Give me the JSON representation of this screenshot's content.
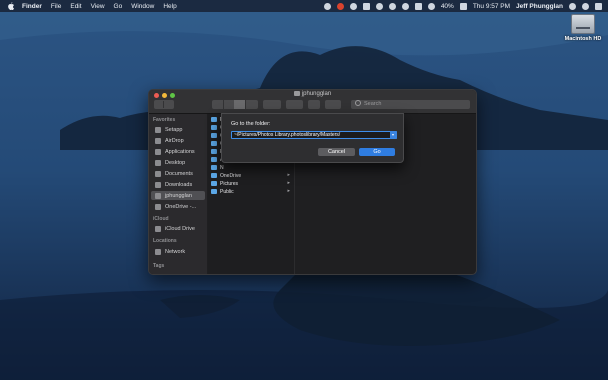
{
  "menubar": {
    "items": [
      "Finder",
      "File",
      "Edit",
      "View",
      "Go",
      "Window",
      "Help"
    ],
    "battery": "40%",
    "clock": "Thu 9:57 PM",
    "user": "Jeff Phungglan"
  },
  "desktop": {
    "disk_label": "Macintosh HD"
  },
  "finder": {
    "title": "jphungglan",
    "search_placeholder": "Search",
    "sidebar": {
      "favorites_header": "Favorites",
      "favorites": [
        "Setapp",
        "AirDrop",
        "Applications",
        "Desktop",
        "Documents",
        "Downloads",
        "jphungglan",
        "OneDrive -..."
      ],
      "icloud_header": "iCloud",
      "icloud": [
        "iCloud Drive"
      ],
      "locations_header": "Locations",
      "locations": [
        "Network"
      ],
      "tags_header": "Tags"
    },
    "column": {
      "items": [
        "P",
        "C",
        "C",
        "C",
        "F",
        "A",
        "N",
        "OneDrive",
        "Pictures",
        "Public"
      ]
    }
  },
  "goto_sheet": {
    "prompt": "Go to the folder:",
    "value": "~/Pictures/Photos Library.photoslibrary/Masters/",
    "cancel_label": "Cancel",
    "go_label": "Go"
  },
  "colors": {
    "accent": "#2f7de1",
    "folder": "#5ba7e6",
    "window_bg": "#1f1f21"
  }
}
